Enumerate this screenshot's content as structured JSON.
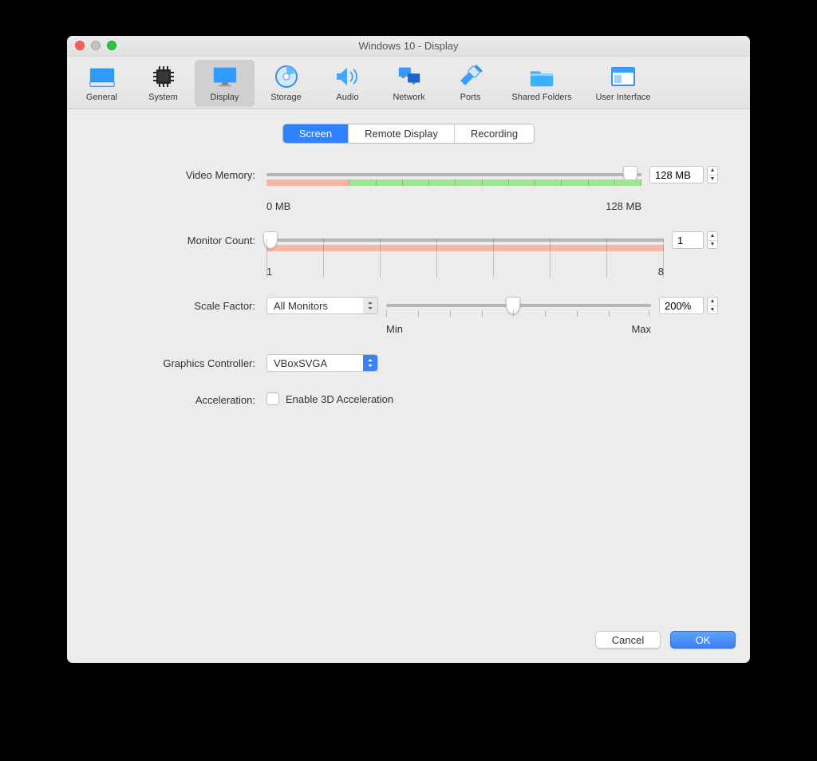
{
  "window": {
    "title": "Windows 10 - Display"
  },
  "toolbar": {
    "items": [
      {
        "key": "general",
        "label": "General"
      },
      {
        "key": "system",
        "label": "System"
      },
      {
        "key": "display",
        "label": "Display"
      },
      {
        "key": "storage",
        "label": "Storage"
      },
      {
        "key": "audio",
        "label": "Audio"
      },
      {
        "key": "network",
        "label": "Network"
      },
      {
        "key": "ports",
        "label": "Ports"
      },
      {
        "key": "shared-folders",
        "label": "Shared Folders"
      },
      {
        "key": "user-interface",
        "label": "User Interface"
      }
    ],
    "active": "display"
  },
  "tabs": {
    "items": [
      {
        "key": "screen",
        "label": "Screen"
      },
      {
        "key": "remote",
        "label": "Remote Display"
      },
      {
        "key": "recording",
        "label": "Recording"
      }
    ],
    "active": "screen"
  },
  "fields": {
    "video_memory": {
      "label": "Video Memory:",
      "min_label": "0 MB",
      "max_label": "128 MB",
      "value": "128 MB",
      "slider_pct": 97,
      "color_split_pct": 22
    },
    "monitor_count": {
      "label": "Monitor Count:",
      "min_label": "1",
      "max_label": "8",
      "value": "1",
      "slider_pct": 0
    },
    "scale_factor": {
      "label": "Scale Factor:",
      "popup": "All Monitors",
      "min_label": "Min",
      "max_label": "Max",
      "value": "200%",
      "slider_pct": 48
    },
    "graphics_controller": {
      "label": "Graphics Controller:",
      "value": "VBoxSVGA"
    },
    "acceleration": {
      "label": "Acceleration:",
      "checkbox_label": "Enable 3D Acceleration",
      "checked": false
    }
  },
  "buttons": {
    "cancel": "Cancel",
    "ok": "OK"
  }
}
